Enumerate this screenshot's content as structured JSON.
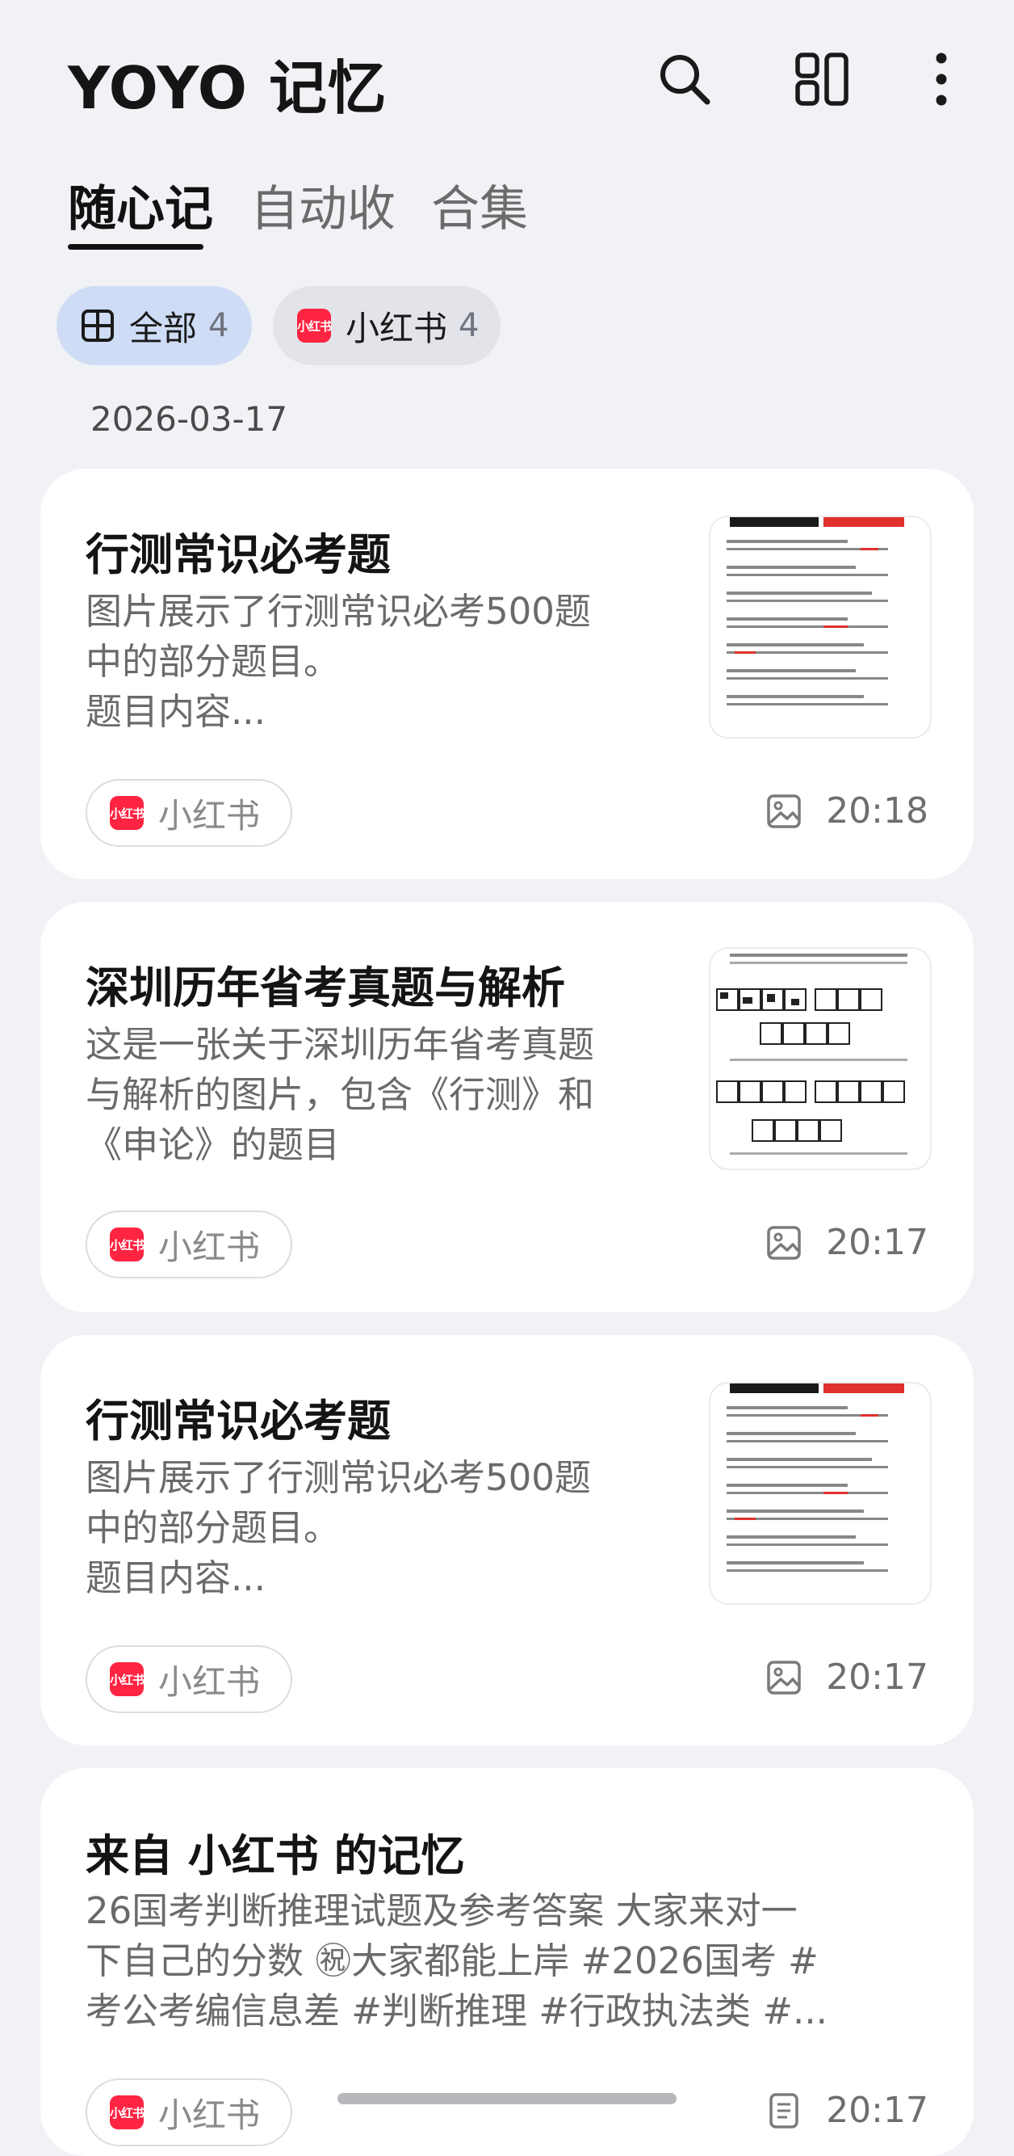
{
  "header": {
    "title": "YOYO 记忆",
    "icons": [
      "search-icon",
      "layout-icon",
      "more-icon"
    ]
  },
  "tabs": [
    {
      "label": "随心记",
      "active": true
    },
    {
      "label": "自动收",
      "active": false
    },
    {
      "label": "合集",
      "active": false
    }
  ],
  "filters": [
    {
      "label": "全部",
      "count": "4",
      "icon": "grid-icon",
      "selected": true
    },
    {
      "label": "小红书",
      "count": "4",
      "icon": "xiaohongshu-logo",
      "selected": false
    }
  ],
  "date_group": "2026-03-17",
  "cards": [
    {
      "title": "行测常识必考题",
      "body": "图片展示了行测常识必考500题\n中的部分题目。\n题目内容...",
      "source": "小红书",
      "time": "20:18",
      "type_icon": "image-icon"
    },
    {
      "title": "深圳历年省考真题与解析",
      "body": "这是一张关于深圳历年省考真题\n与解析的图片，包含《行测》和\n《申论》的题目",
      "source": "小红书",
      "time": "20:17",
      "type_icon": "image-icon"
    },
    {
      "title": "行测常识必考题",
      "body": "图片展示了行测常识必考500题\n中的部分题目。\n题目内容...",
      "source": "小红书",
      "time": "20:17",
      "type_icon": "image-icon"
    },
    {
      "title": "来自 小红书 的记忆",
      "body": "26国考判断推理试题及参考答案 大家来对一\n下自己的分数 ㊗大家都能上岸 #2026国考 #\n考公考编信息差 #判断推理 #行政执法类 #...",
      "source": "小红书",
      "time": "20:17",
      "type_icon": "document-icon"
    }
  ],
  "brand": {
    "xhs_logo_text": "小红书",
    "xhs_color": "#ff2442",
    "chip_selected_bg": "#cfdcf5"
  }
}
